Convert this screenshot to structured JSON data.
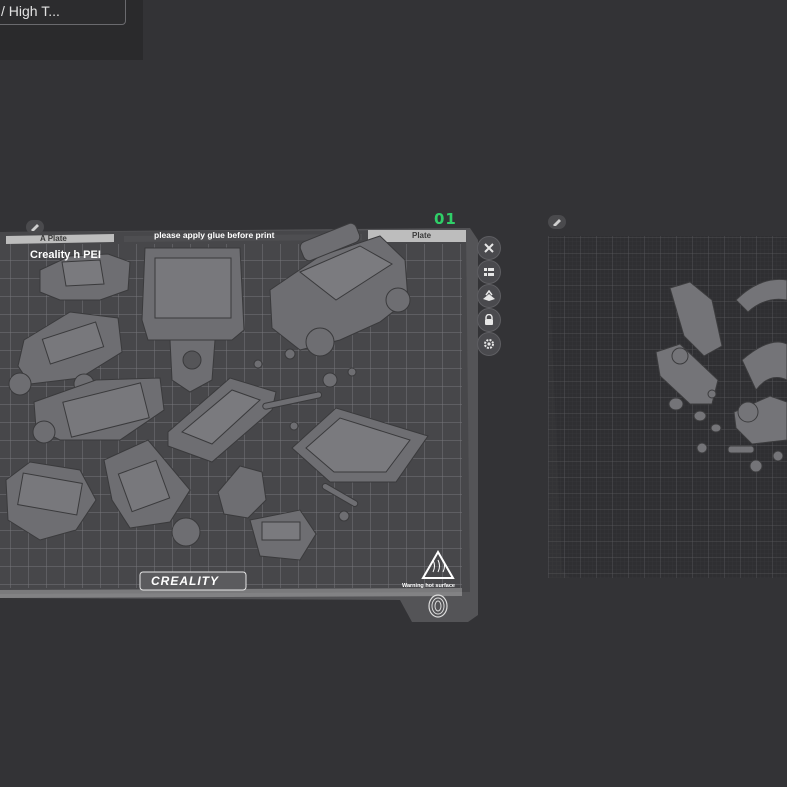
{
  "toolbar": {
    "preset_text": "/ High T..."
  },
  "plate1": {
    "number": "01",
    "name_label": "A Plate",
    "name_label_right": "Plate",
    "glue_note": "please apply glue before print",
    "brand_title": "Creality         h PEI",
    "logo": "CREALITY",
    "warning": "Warning hot surface"
  },
  "plate_tools": [
    {
      "name": "close-icon"
    },
    {
      "name": "arrange-icon"
    },
    {
      "name": "orient-icon"
    },
    {
      "name": "lock-icon"
    },
    {
      "name": "settings-icon"
    }
  ],
  "colors": {
    "background": "#333336",
    "plate_number": "#2fcf68",
    "bed": "#4b4b4d",
    "grid": "#6c6c70",
    "model": "#6e6e72"
  }
}
